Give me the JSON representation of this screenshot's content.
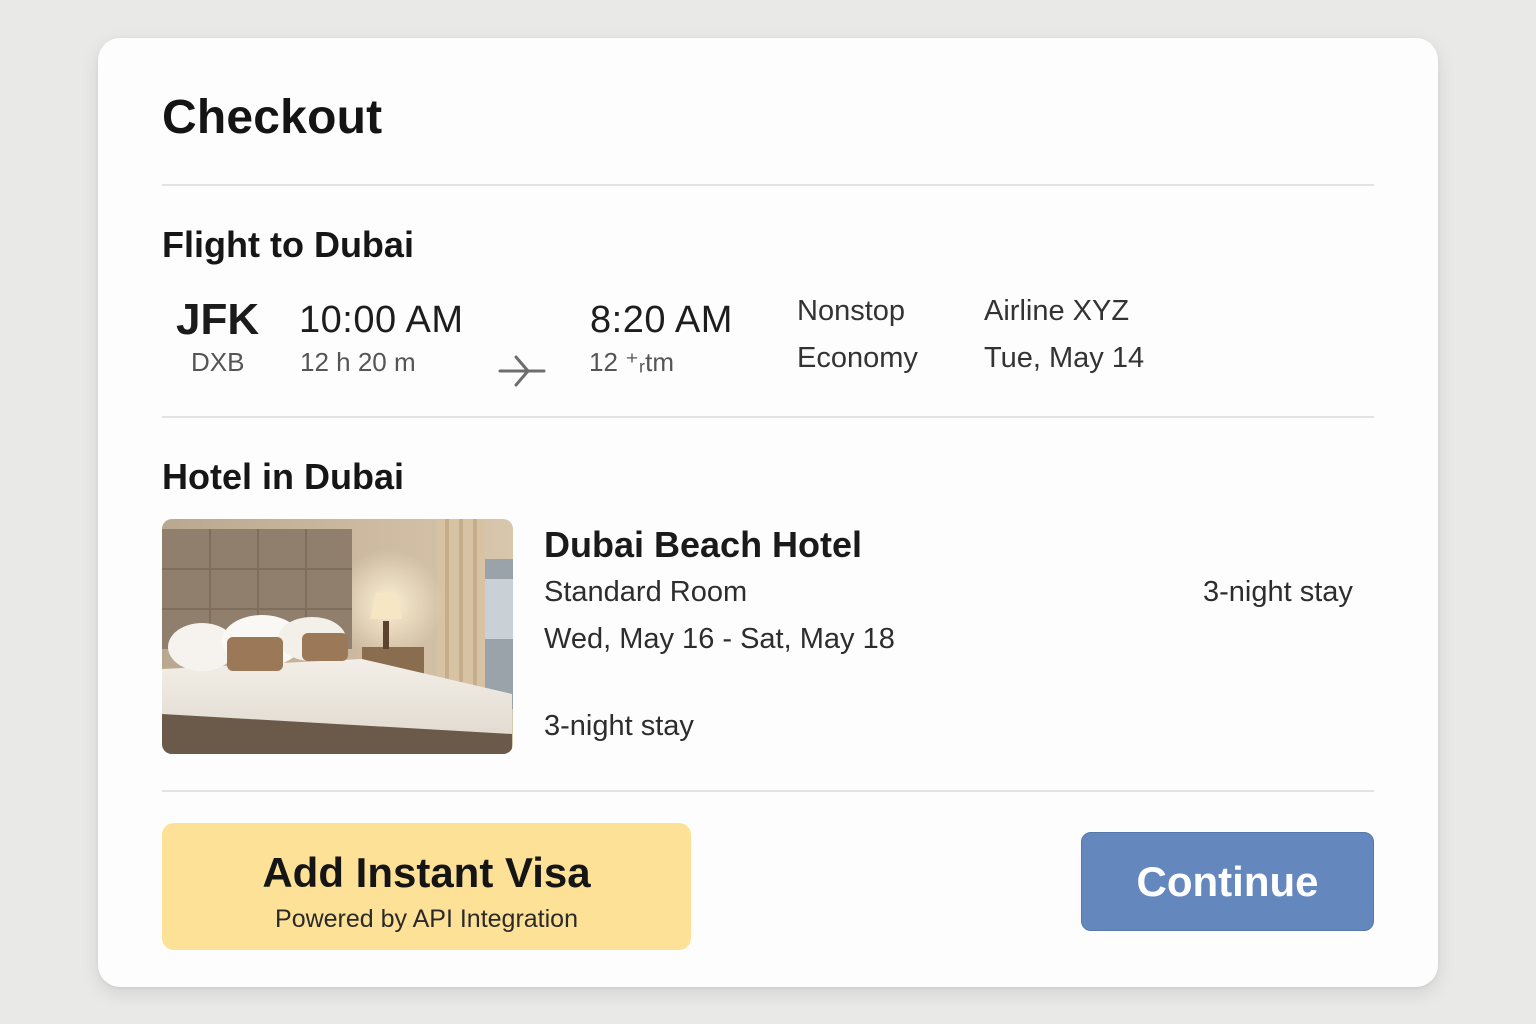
{
  "header": {
    "title": "Checkout"
  },
  "flight": {
    "section_title": "Flight to Dubai",
    "origin_code": "JFK",
    "destination_code": "DXB",
    "departure_time": "10:00 AM",
    "duration": "12 h 20 m",
    "arrival_time": "8:20 AM",
    "arrival_sub": "12 ⁺ᵣtm",
    "stops": "Nonstop",
    "cabin": "Economy",
    "airline": "Airline XYZ",
    "date": "Tue, May 14",
    "arrow_icon": "plane-arrow-icon"
  },
  "hotel": {
    "section_title": "Hotel in Dubai",
    "name": "Dubai Beach Hotel",
    "room_type": "Standard Room",
    "dates": "Wed, May 16 - Sat, May 18",
    "stay_length": "3-night stay",
    "stay_length_right": "3-night stay",
    "image": "hotel-room-photo"
  },
  "actions": {
    "visa_label": "Add Instant Visa",
    "visa_sublabel": "Powered by API Integration",
    "continue_label": "Continue"
  },
  "colors": {
    "visa_button": "#fde197",
    "continue_button": "#6487bd",
    "background": "#e9e9e8",
    "card": "#fdfdfd"
  }
}
